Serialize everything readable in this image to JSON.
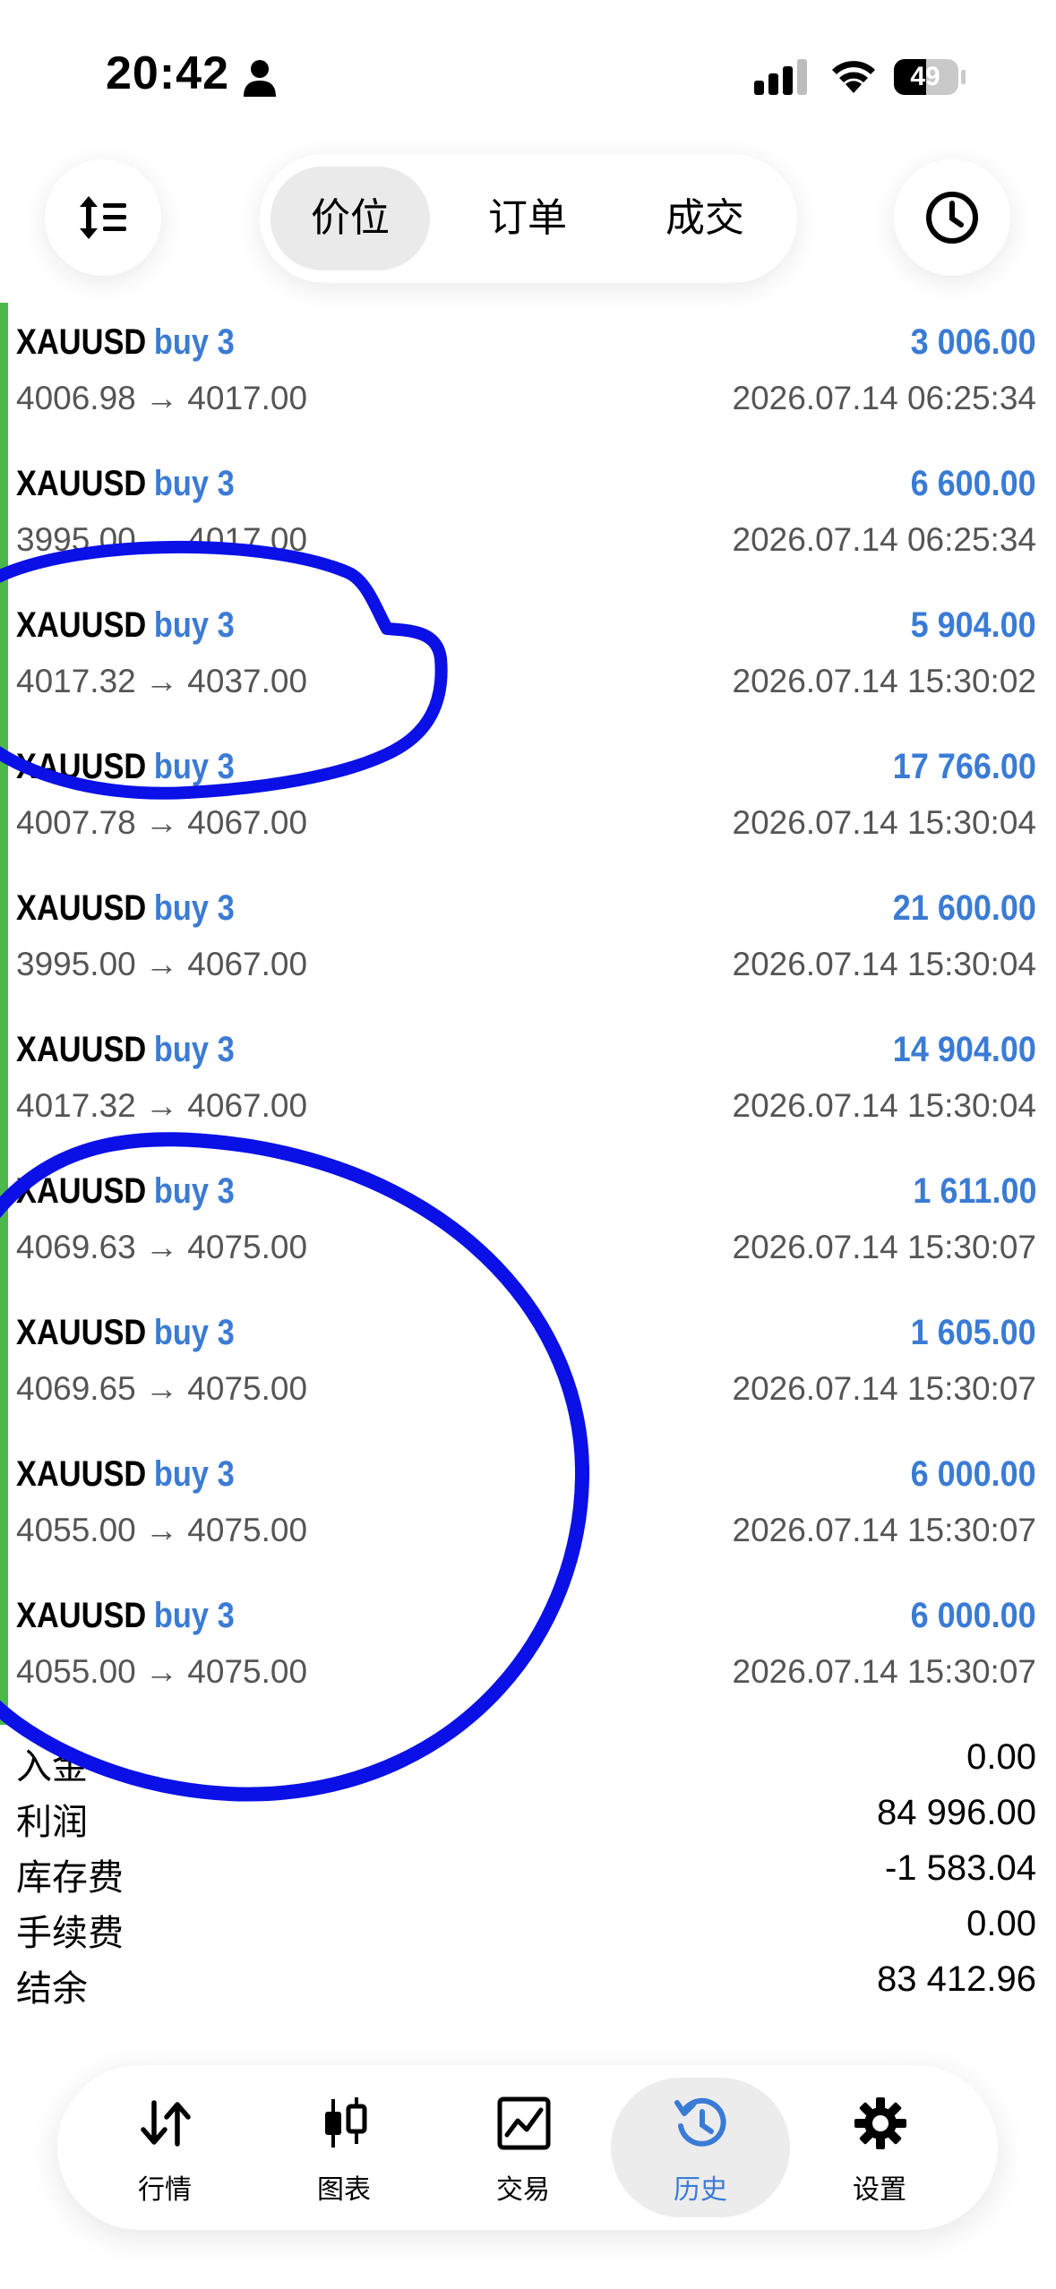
{
  "status_bar": {
    "time": "20:42",
    "battery": "49"
  },
  "header": {
    "segments": [
      "价位",
      "订单",
      "成交"
    ],
    "active_segment": 0
  },
  "deals": [
    {
      "symbol": "XAUUSD",
      "side": "buy 3",
      "profit": "3 006.00",
      "prices": "4006.98 → 4017.00",
      "time": "2026.07.14 06:25:34"
    },
    {
      "symbol": "XAUUSD",
      "side": "buy 3",
      "profit": "6 600.00",
      "prices": "3995.00 → 4017.00",
      "time": "2026.07.14 06:25:34"
    },
    {
      "symbol": "XAUUSD",
      "side": "buy 3",
      "profit": "5 904.00",
      "prices": "4017.32 → 4037.00",
      "time": "2026.07.14 15:30:02"
    },
    {
      "symbol": "XAUUSD",
      "side": "buy 3",
      "profit": "17 766.00",
      "prices": "4007.78 → 4067.00",
      "time": "2026.07.14 15:30:04"
    },
    {
      "symbol": "XAUUSD",
      "side": "buy 3",
      "profit": "21 600.00",
      "prices": "3995.00 → 4067.00",
      "time": "2026.07.14 15:30:04"
    },
    {
      "symbol": "XAUUSD",
      "side": "buy 3",
      "profit": "14 904.00",
      "prices": "4017.32 → 4067.00",
      "time": "2026.07.14 15:30:04"
    },
    {
      "symbol": "XAUUSD",
      "side": "buy 3",
      "profit": "1 611.00",
      "prices": "4069.63 → 4075.00",
      "time": "2026.07.14 15:30:07"
    },
    {
      "symbol": "XAUUSD",
      "side": "buy 3",
      "profit": "1 605.00",
      "prices": "4069.65 → 4075.00",
      "time": "2026.07.14 15:30:07"
    },
    {
      "symbol": "XAUUSD",
      "side": "buy 3",
      "profit": "6 000.00",
      "prices": "4055.00 → 4075.00",
      "time": "2026.07.14 15:30:07"
    },
    {
      "symbol": "XAUUSD",
      "side": "buy 3",
      "profit": "6 000.00",
      "prices": "4055.00 → 4075.00",
      "time": "2026.07.14 15:30:07"
    }
  ],
  "summary": [
    {
      "label": "入金",
      "value": "0.00"
    },
    {
      "label": "利润",
      "value": "84 996.00"
    },
    {
      "label": "库存费",
      "value": "-1 583.04"
    },
    {
      "label": "手续费",
      "value": "0.00"
    },
    {
      "label": "结余",
      "value": "83 412.96"
    }
  ],
  "tabs": [
    {
      "label": "行情",
      "icon": "arrows-updown-icon"
    },
    {
      "label": "图表",
      "icon": "candlestick-icon"
    },
    {
      "label": "交易",
      "icon": "trade-chart-icon"
    },
    {
      "label": "历史",
      "icon": "history-icon"
    },
    {
      "label": "设置",
      "icon": "gear-icon"
    }
  ],
  "active_tab": 3,
  "colors": {
    "accent": "#3a7bd5",
    "bar": "#4cb84c",
    "annotation": "#0a10e6"
  }
}
